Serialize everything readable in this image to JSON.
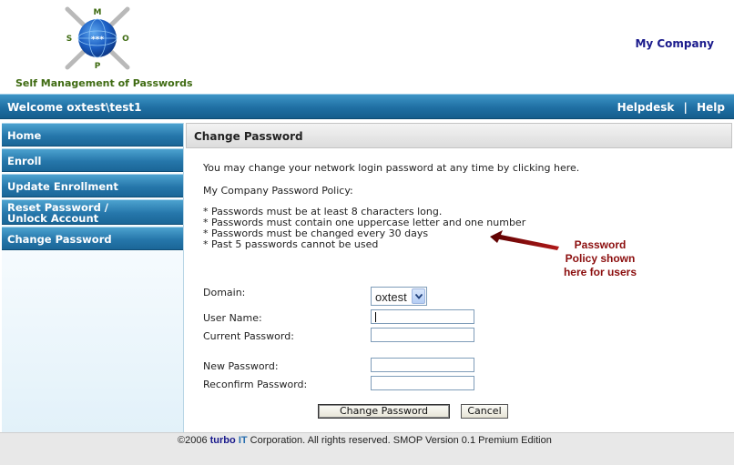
{
  "header": {
    "logo_letters": {
      "top": "M",
      "left": "S",
      "right": "O",
      "bottom": "P",
      "center": "***"
    },
    "tagline": "Self Management of Passwords",
    "company": "My Company"
  },
  "welcome_bar": {
    "welcome": "Welcome oxtest\\test1",
    "links": [
      "Helpdesk",
      "Help"
    ],
    "separator": "|"
  },
  "nav": {
    "home": "Home",
    "enroll": "Enroll",
    "update_enrollment": "Update Enrollment",
    "reset_line1": "Reset Password /",
    "reset_line2": "Unlock Account",
    "change_password": "Change Password"
  },
  "main": {
    "title": "Change Password",
    "intro": "You may change your network login password at any time by clicking here.",
    "policy_heading": "My Company Password Policy:",
    "policy_lines": [
      "* Passwords must be at least 8 characters long.",
      "* Passwords must contain one uppercase letter and one number",
      "* Passwords must be changed every 30 days",
      "* Past 5 passwords cannot be used"
    ],
    "annotation_lines": [
      "Password",
      "Policy shown",
      "here for users"
    ]
  },
  "form": {
    "domain_label": "Domain:",
    "domain_value": "oxtest",
    "username_label": "User Name:",
    "username_value": "",
    "current_label": "Current Password:",
    "current_value": "",
    "new_label": "New Password:",
    "new_value": "",
    "reconfirm_label": "Reconfirm Password:",
    "reconfirm_value": "",
    "submit_label": "Change Password",
    "cancel_label": "Cancel"
  },
  "footer": {
    "prefix": "©2006 ",
    "brand_part1": "turbo",
    "brand_part2": "IT",
    "suffix": " Corporation. All rights reserved. SMOP Version 0.1 Premium Edition"
  },
  "colors": {
    "nav_blue": "#2677ab",
    "bar_blue": "#1f6fa3",
    "tagline_green": "#3f6b12",
    "company_navy": "#1a1a8c",
    "annotation_red": "#8b0d0d"
  }
}
